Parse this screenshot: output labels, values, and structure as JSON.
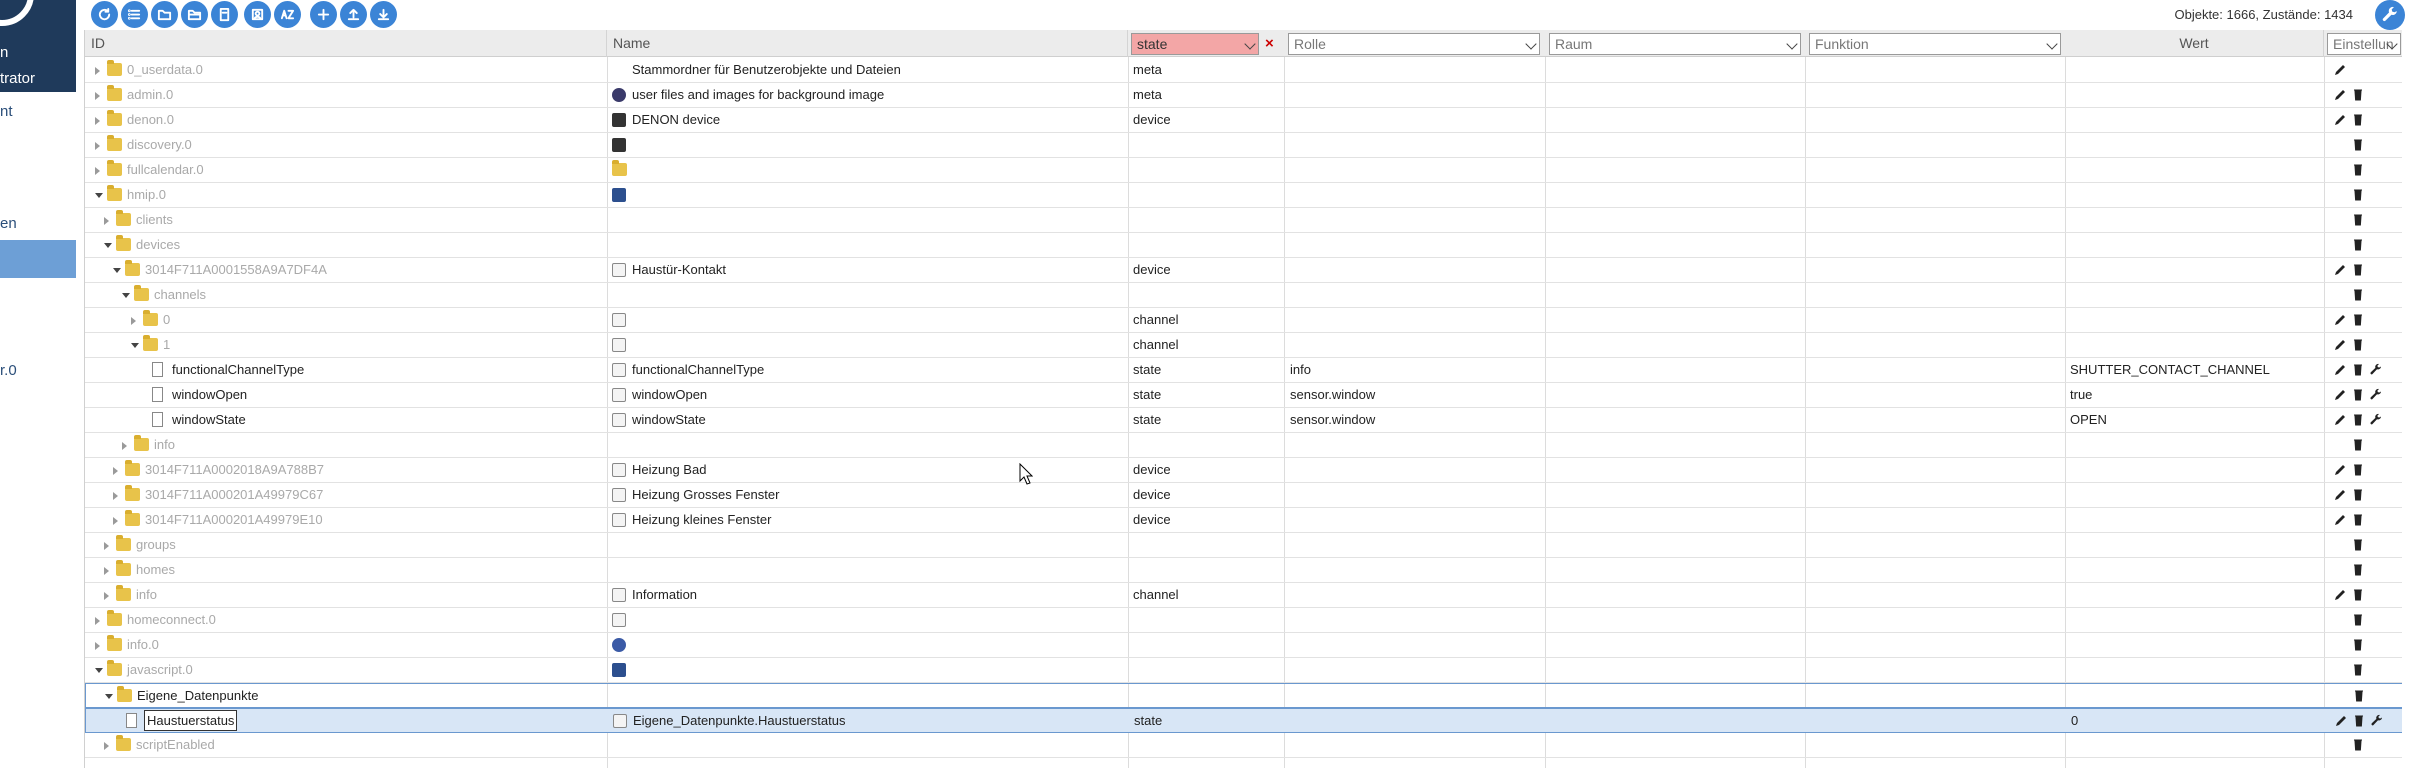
{
  "sidebar": {
    "brand_line1": "n",
    "brand_line2": "trator",
    "items": [
      {
        "label": "nt"
      },
      {
        "label": "en"
      },
      {
        "label": ""
      },
      {
        "label": "r.0"
      }
    ]
  },
  "toolbar": {
    "buttons": [
      "refresh-icon",
      "list-icon",
      "folder-icon",
      "folder-open-icon",
      "document-icon",
      "user-icon",
      "sort-az-icon",
      "add-icon",
      "upload-icon",
      "download-icon"
    ],
    "counts": "Objekte: 1666, Zustände: 1434"
  },
  "columns": {
    "id": "ID",
    "name": "Name",
    "type_filter": "state",
    "role": "Rolle",
    "room": "Raum",
    "function": "Funktion",
    "value": "Wert",
    "settings": "Einstellun"
  },
  "rows": [
    {
      "id": "0_userdata.0",
      "name": "Stammordner für Benutzerobjekte und Dateien",
      "type": "meta",
      "role": "",
      "value": ""
    },
    {
      "id": "admin.0",
      "name": "user files and images for background image",
      "type": "meta",
      "role": "",
      "value": ""
    },
    {
      "id": "denon.0",
      "name": "DENON device",
      "type": "device",
      "role": "",
      "value": ""
    },
    {
      "id": "discovery.0",
      "name": "",
      "type": "",
      "role": "",
      "value": ""
    },
    {
      "id": "fullcalendar.0",
      "name": "",
      "type": "",
      "role": "",
      "value": ""
    },
    {
      "id": "hmip.0",
      "name": "",
      "type": "",
      "role": "",
      "value": ""
    },
    {
      "id": "clients",
      "name": "",
      "type": "",
      "role": "",
      "value": ""
    },
    {
      "id": "devices",
      "name": "",
      "type": "",
      "role": "",
      "value": ""
    },
    {
      "id": "3014F711A0001558A9A7DF4A",
      "name": "Haustür-Kontakt",
      "type": "device",
      "role": "",
      "value": ""
    },
    {
      "id": "channels",
      "name": "",
      "type": "",
      "role": "",
      "value": ""
    },
    {
      "id": "0",
      "name": "",
      "type": "channel",
      "role": "",
      "value": ""
    },
    {
      "id": "1",
      "name": "",
      "type": "channel",
      "role": "",
      "value": ""
    },
    {
      "id": "functionalChannelType",
      "name": "functionalChannelType",
      "type": "state",
      "role": "info",
      "value": "SHUTTER_CONTACT_CHANNEL"
    },
    {
      "id": "windowOpen",
      "name": "windowOpen",
      "type": "state",
      "role": "sensor.window",
      "value": "true"
    },
    {
      "id": "windowState",
      "name": "windowState",
      "type": "state",
      "role": "sensor.window",
      "value": "OPEN"
    },
    {
      "id": "info",
      "name": "",
      "type": "",
      "role": "",
      "value": ""
    },
    {
      "id": "3014F711A0002018A9A788B7",
      "name": "Heizung Bad",
      "type": "device",
      "role": "",
      "value": ""
    },
    {
      "id": "3014F711A000201A49979C67",
      "name": "Heizung Grosses Fenster",
      "type": "device",
      "role": "",
      "value": ""
    },
    {
      "id": "3014F711A000201A49979E10",
      "name": "Heizung kleines Fenster",
      "type": "device",
      "role": "",
      "value": ""
    },
    {
      "id": "groups",
      "name": "",
      "type": "",
      "role": "",
      "value": ""
    },
    {
      "id": "homes",
      "name": "",
      "type": "",
      "role": "",
      "value": ""
    },
    {
      "id": "info",
      "name": "Information",
      "type": "channel",
      "role": "",
      "value": ""
    },
    {
      "id": "homeconnect.0",
      "name": "",
      "type": "",
      "role": "",
      "value": ""
    },
    {
      "id": "info.0",
      "name": "",
      "type": "",
      "role": "",
      "value": ""
    },
    {
      "id": "javascript.0",
      "name": "",
      "type": "",
      "role": "",
      "value": ""
    },
    {
      "id": "Eigene_Datenpunkte",
      "name": "",
      "type": "",
      "role": "",
      "value": ""
    },
    {
      "id": "Haustuerstatus",
      "name": "Eigene_Datenpunkte.Haustuerstatus",
      "type": "state",
      "role": "",
      "value": "0"
    },
    {
      "id": "scriptEnabled",
      "name": "",
      "type": "",
      "role": "",
      "value": ""
    }
  ],
  "colors": {
    "accent": "#3b84d6",
    "brand": "#1f3a5b",
    "filter_active": "#f3a6a6",
    "selection": "#d8e6f6",
    "folder": "#e8c34a"
  }
}
